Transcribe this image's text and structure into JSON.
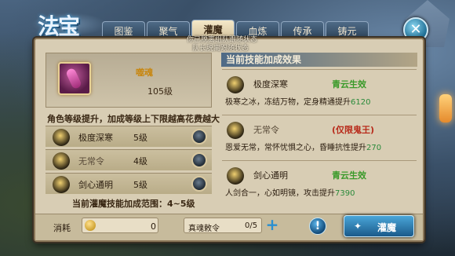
{
  "header": {
    "logo_text": "法宝",
    "status_line1": "你已脱离组队跟随状态",
    "status_line2": "队长脱离跟随状态"
  },
  "tabs": [
    {
      "label": "图鉴",
      "active": false
    },
    {
      "label": "聚气",
      "active": false
    },
    {
      "label": "灌魔",
      "active": true
    },
    {
      "label": "血炼",
      "active": false
    },
    {
      "label": "传承",
      "active": false
    },
    {
      "label": "铸元",
      "active": false
    }
  ],
  "weapon": {
    "name": "噬魂",
    "level": "105级"
  },
  "left": {
    "note": "角色等级提升，加成等级上下限越高花费越大",
    "skills": [
      {
        "name": "极度深寒",
        "level": "5级",
        "dim": false
      },
      {
        "name": "无常令",
        "level": "4级",
        "dim": true
      },
      {
        "name": "剑心通明",
        "level": "5级",
        "dim": false
      }
    ],
    "range_note": "当前灌魔技能加成范围：4~5级"
  },
  "right": {
    "header": "当前技能加成效果",
    "effects": [
      {
        "name": "极度深寒",
        "tag": "青云生效",
        "tag_color": "green",
        "desc": "极寒之冰，冻结万物，定身精通提升",
        "value": "6120"
      },
      {
        "name": "无常令",
        "tag": "(仅限鬼王)",
        "tag_color": "red",
        "desc": "恩爱无常，常怀忧惧之心，昏睡抗性提升",
        "value": "270"
      },
      {
        "name": "剑心通明",
        "tag": "青云生效",
        "tag_color": "green",
        "desc": "人剑合一，心如明镜，攻击提升",
        "value": "7390"
      }
    ]
  },
  "bottom": {
    "cost_label": "消耗",
    "cost_value": "0",
    "token_label": "真魂敕令",
    "token_value": "0/5",
    "add_symbol": "+",
    "info_symbol": "!",
    "action_label": "灌魔"
  },
  "close_symbol": "✕"
}
